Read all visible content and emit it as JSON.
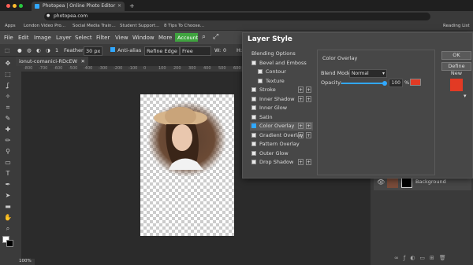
{
  "browser": {
    "tab_title": "Photopea | Online Photo Editor",
    "url": "photopea.com",
    "bookmarks": [
      "Apps",
      "London Video Pro...",
      "Social Media Train...",
      "Student Support...",
      "8 Tips To Choose...",
      "Reading List"
    ]
  },
  "menu": {
    "items": [
      "File",
      "Edit",
      "Image",
      "Layer",
      "Select",
      "Filter",
      "View",
      "Window",
      "More"
    ],
    "account": "Account"
  },
  "options": {
    "size": "1",
    "feather_label": "Feather:",
    "feather_value": "30 px",
    "anti_alias": "Anti-alias",
    "refine_edge": "Refine Edge",
    "style": "Free",
    "width_label": "W:",
    "width_value": "0",
    "height_label": "H:"
  },
  "document": {
    "tab": "ionut-comanici-RDcEW",
    "zoom": "100%",
    "ruler_ticks": [
      "-800",
      "-700",
      "-600",
      "-500",
      "-400",
      "-300",
      "-200",
      "-100",
      "0",
      "100",
      "200",
      "300",
      "400",
      "500",
      "600"
    ]
  },
  "dialog": {
    "title": "Layer Style",
    "styles": [
      {
        "label": "Blending Options",
        "header": true
      },
      {
        "label": "Bevel and Emboss",
        "checked": false
      },
      {
        "label": "Contour",
        "checked": false,
        "indent": true
      },
      {
        "label": "Texture",
        "checked": false,
        "indent": true
      },
      {
        "label": "Stroke",
        "checked": false,
        "plus": true
      },
      {
        "label": "Inner Shadow",
        "checked": false,
        "plus": true
      },
      {
        "label": "Inner Glow",
        "checked": false
      },
      {
        "label": "Satin",
        "checked": false
      },
      {
        "label": "Color Overlay",
        "checked": true,
        "plus": true,
        "selected": true
      },
      {
        "label": "Gradient Overlay",
        "checked": false,
        "plus": true
      },
      {
        "label": "Pattern Overlay",
        "checked": false
      },
      {
        "label": "Outer Glow",
        "checked": false
      },
      {
        "label": "Drop Shadow",
        "checked": false,
        "plus": true
      }
    ],
    "group_title": "Color Overlay",
    "blend_mode_label": "Blend Mode:",
    "blend_mode": "Normal",
    "opacity_label": "Opacity:",
    "opacity_value": "100",
    "opacity_unit": "%",
    "opacity_level": 1.0,
    "overlay_color": "#e23a24",
    "ok": "OK",
    "define_new": "Define New"
  },
  "layers": {
    "background": "Background"
  },
  "colors": {
    "accent": "#31a8ff",
    "account": "#3fa33f",
    "overlay": "#e23a24"
  }
}
